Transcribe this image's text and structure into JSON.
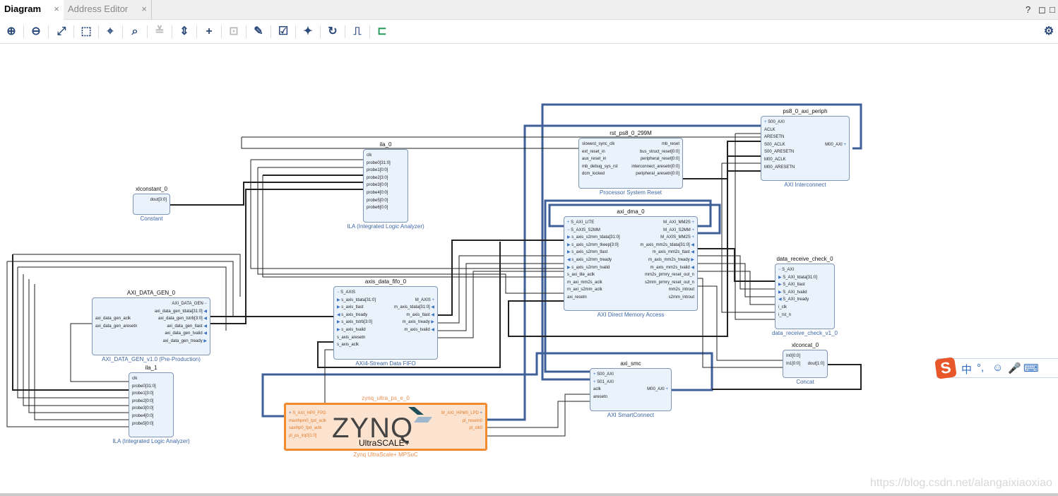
{
  "tabs": [
    {
      "label": "Diagram",
      "active": true
    },
    {
      "label": "Address Editor",
      "active": false
    }
  ],
  "tab_close": "×",
  "window_buttons": {
    "help": "?",
    "restore": "◻",
    "maximize": "□"
  },
  "toolbar": {
    "icons": [
      "zoom-in",
      "zoom-out",
      "fit-view",
      "zoom-area",
      "center",
      "search",
      "collapse-all",
      "expand-all",
      "add-ip",
      "make-connection",
      "properties",
      "validate-design",
      "pin",
      "regenerate-layout",
      "optimize-routing",
      "toggle-interface"
    ],
    "settings": "gear"
  },
  "blocks": [
    {
      "id": "xlconstant_0",
      "name": "xlconstant_0",
      "subtitle": "Constant",
      "left": [],
      "right": [
        {
          "l": "dout[3:0]",
          "k": "pin"
        }
      ]
    },
    {
      "id": "ila_0",
      "name": "ila_0",
      "subtitle": "ILA (Integrated Logic Analyzer)",
      "left": [
        {
          "l": "clk",
          "k": "pin"
        },
        {
          "l": "probe0[31:0]",
          "k": "pin"
        },
        {
          "l": "probe1[0:0]",
          "k": "pin"
        },
        {
          "l": "probe2[3:0]",
          "k": "pin"
        },
        {
          "l": "probe3[0:0]",
          "k": "pin"
        },
        {
          "l": "probe4[0:0]",
          "k": "pin"
        },
        {
          "l": "probe5[0:0]",
          "k": "pin"
        },
        {
          "l": "probe6[0:0]",
          "k": "pin"
        }
      ],
      "right": []
    },
    {
      "id": "axi_data_gen",
      "name": "AXI_DATA_GEN_0",
      "subtitle": "AXI_DATA_GEN_v1.0 (Pre-Production)",
      "left": [
        {
          "l": "",
          "k": "pin"
        },
        {
          "l": "",
          "k": "pin"
        },
        {
          "l": "axi_data_gen_aclk",
          "k": "pin"
        },
        {
          "l": "axi_data_gen_aresetn",
          "k": "pin"
        }
      ],
      "right": [
        {
          "l": "AXI_DATA_GEN",
          "k": "bus_minus"
        },
        {
          "l": "axi_data_gen_tdata[31:0]",
          "k": "out"
        },
        {
          "l": "axi_data_gen_tstrb[3:0]",
          "k": "out"
        },
        {
          "l": "axi_data_gen_tlast",
          "k": "out"
        },
        {
          "l": "axi_data_gen_tvalid",
          "k": "out"
        },
        {
          "l": "axi_data_gen_tready",
          "k": "in"
        }
      ]
    },
    {
      "id": "ila_1",
      "name": "ila_1",
      "subtitle": "ILA (Integrated Logic Analyzer)",
      "left": [
        {
          "l": "clk",
          "k": "pin"
        },
        {
          "l": "probe0[31:0]",
          "k": "pin"
        },
        {
          "l": "probe1[3:0]",
          "k": "pin"
        },
        {
          "l": "probe2[0:0]",
          "k": "pin"
        },
        {
          "l": "probe3[0:0]",
          "k": "pin"
        },
        {
          "l": "probe4[0:0]",
          "k": "pin"
        },
        {
          "l": "probe5[0:0]",
          "k": "pin"
        }
      ],
      "right": []
    },
    {
      "id": "axis_data_fifo_0",
      "name": "axis_data_fifo_0",
      "subtitle": "AXI4-Stream Data FIFO",
      "left": [
        {
          "l": "S_AXIS",
          "k": "bus_minus"
        },
        {
          "l": "s_axis_tdata[31:0]",
          "k": "in"
        },
        {
          "l": "s_axis_tlast",
          "k": "in"
        },
        {
          "l": "s_axis_tready",
          "k": "out"
        },
        {
          "l": "s_axis_tstrb[3:0]",
          "k": "in"
        },
        {
          "l": "s_axis_tvalid",
          "k": "in"
        },
        {
          "l": "s_axis_aresetn",
          "k": "pin"
        },
        {
          "l": "s_axis_aclk",
          "k": "pin"
        }
      ],
      "right": [
        {
          "l": "",
          "k": "pin"
        },
        {
          "l": "M_AXIS",
          "k": "bus_plus"
        },
        {
          "l": "m_axis_tdata[31:0]",
          "k": "out"
        },
        {
          "l": "m_axis_tlast",
          "k": "out"
        },
        {
          "l": "m_axis_tready",
          "k": "in"
        },
        {
          "l": "m_axis_tvalid",
          "k": "out"
        }
      ]
    },
    {
      "id": "zynq_ultra_ps_e_0",
      "name": "zynq_ultra_ps_e_0",
      "subtitle": "Zynq UltraScale+ MPSoC",
      "logo": "ZYNQ",
      "logo2": "UltraSCALE+",
      "left": [
        {
          "l": "S_AXI_HP0_FPD",
          "k": "bus_plus"
        },
        {
          "l": "maxihpm0_lpd_aclk",
          "k": "pin"
        },
        {
          "l": "saxihp0_fpd_aclk",
          "k": "pin"
        },
        {
          "l": "pl_ps_irq0[1:0]",
          "k": "pin"
        }
      ],
      "right": [
        {
          "l": "M_AXI_HPM0_LPD",
          "k": "bus_plus"
        },
        {
          "l": "pl_resetn0",
          "k": "pin"
        },
        {
          "l": "pl_clk0",
          "k": "pin"
        }
      ]
    },
    {
      "id": "rst_ps8_0_299M",
      "name": "rst_ps8_0_299M",
      "subtitle": "Processor System Reset",
      "left": [
        {
          "l": "slowest_sync_clk",
          "k": "pin"
        },
        {
          "l": "ext_reset_in",
          "k": "pin"
        },
        {
          "l": "aux_reset_in",
          "k": "pin"
        },
        {
          "l": "mb_debug_sys_rst",
          "k": "pin"
        },
        {
          "l": "dcm_locked",
          "k": "pin"
        }
      ],
      "right": [
        {
          "l": "mb_reset",
          "k": "pin"
        },
        {
          "l": "bus_struct_reset[0:0]",
          "k": "pin"
        },
        {
          "l": "peripheral_reset[0:0]",
          "k": "pin"
        },
        {
          "l": "interconnect_aresetn[0:0]",
          "k": "pin"
        },
        {
          "l": "peripheral_aresetn[0:0]",
          "k": "pin"
        }
      ]
    },
    {
      "id": "ps8_0_axi_periph",
      "name": "ps8_0_axi_periph",
      "subtitle": "AXI Interconnect",
      "left": [
        {
          "l": "S00_AXI",
          "k": "bus_plus"
        },
        {
          "l": "ACLK",
          "k": "pin"
        },
        {
          "l": "ARESETN",
          "k": "pin"
        },
        {
          "l": "S00_ACLK",
          "k": "pin"
        },
        {
          "l": "S00_ARESETN",
          "k": "pin"
        },
        {
          "l": "M00_ACLK",
          "k": "pin"
        },
        {
          "l": "M00_ARESETN",
          "k": "pin"
        }
      ],
      "right": [
        {
          "l": "",
          "k": "pin"
        },
        {
          "l": "",
          "k": "pin"
        },
        {
          "l": "",
          "k": "pin"
        },
        {
          "l": "M00_AXI",
          "k": "bus_plus"
        }
      ]
    },
    {
      "id": "axi_dma_0",
      "name": "axi_dma_0",
      "subtitle": "AXI Direct Memory Access",
      "left": [
        {
          "l": "S_AXI_LITE",
          "k": "bus_plus"
        },
        {
          "l": "S_AXIS_S2MM",
          "k": "bus_minus"
        },
        {
          "l": "s_axis_s2mm_tdata[31:0]",
          "k": "in"
        },
        {
          "l": "s_axis_s2mm_tkeep[3:0]",
          "k": "in"
        },
        {
          "l": "s_axis_s2mm_tlast",
          "k": "in"
        },
        {
          "l": "s_axis_s2mm_tready",
          "k": "out"
        },
        {
          "l": "s_axis_s2mm_tvalid",
          "k": "in"
        },
        {
          "l": "s_axi_lite_aclk",
          "k": "pin"
        },
        {
          "l": "m_axi_mm2s_aclk",
          "k": "pin"
        },
        {
          "l": "m_axi_s2mm_aclk",
          "k": "pin"
        },
        {
          "l": "axi_resetn",
          "k": "pin"
        }
      ],
      "right": [
        {
          "l": "M_AXI_MM2S",
          "k": "bus_plus"
        },
        {
          "l": "M_AXI_S2MM",
          "k": "bus_plus"
        },
        {
          "l": "M_AXIS_MM2S",
          "k": "bus_plus"
        },
        {
          "l": "m_axis_mm2s_tdata[31:0]",
          "k": "out"
        },
        {
          "l": "m_axis_mm2s_tlast",
          "k": "out"
        },
        {
          "l": "m_axis_mm2s_tready",
          "k": "in"
        },
        {
          "l": "m_axis_mm2s_tvalid",
          "k": "out"
        },
        {
          "l": "mm2s_prmry_reset_out_n",
          "k": "pin"
        },
        {
          "l": "s2mm_prmry_reset_out_n",
          "k": "pin"
        },
        {
          "l": "mm2s_introut",
          "k": "pin"
        },
        {
          "l": "s2mm_introut",
          "k": "pin"
        }
      ]
    },
    {
      "id": "data_receive_check_0",
      "name": "data_receive_check_0",
      "subtitle": "data_receive_check_v1_0",
      "left": [
        {
          "l": "S_AXI",
          "k": "bus_minus"
        },
        {
          "l": "S_AXI_tdata[31:0]",
          "k": "in"
        },
        {
          "l": "S_AXI_tlast",
          "k": "in"
        },
        {
          "l": "S_AXI_tvalid",
          "k": "in"
        },
        {
          "l": "S_AXI_tready",
          "k": "out"
        },
        {
          "l": "i_clk",
          "k": "pin"
        },
        {
          "l": "i_rst_n",
          "k": "pin"
        }
      ],
      "right": []
    },
    {
      "id": "xlconcat_0",
      "name": "xlconcat_0",
      "subtitle": "Concat",
      "left": [
        {
          "l": "In0[0:0]",
          "k": "pin"
        },
        {
          "l": "In1[0:0]",
          "k": "pin"
        }
      ],
      "right": [
        {
          "l": "",
          "k": "pin"
        },
        {
          "l": "dout[1:0]",
          "k": "pin"
        }
      ]
    },
    {
      "id": "axi_smc",
      "name": "axi_smc",
      "subtitle": "AXI SmartConnect",
      "left": [
        {
          "l": "S00_AXI",
          "k": "bus_plus"
        },
        {
          "l": "S01_AXI",
          "k": "bus_plus"
        },
        {
          "l": "aclk",
          "k": "pin"
        },
        {
          "l": "aresetn",
          "k": "pin"
        }
      ],
      "right": [
        {
          "l": "",
          "k": "pin"
        },
        {
          "l": "",
          "k": "pin"
        },
        {
          "l": "M00_AXI",
          "k": "bus_plus"
        }
      ]
    }
  ],
  "ime_toolbar": {
    "logo": "S",
    "items": [
      "中",
      "°,",
      "☺",
      "🎤",
      "⌨"
    ]
  },
  "watermark": "https://blog.csdn.net/alangaixiaoxiao"
}
